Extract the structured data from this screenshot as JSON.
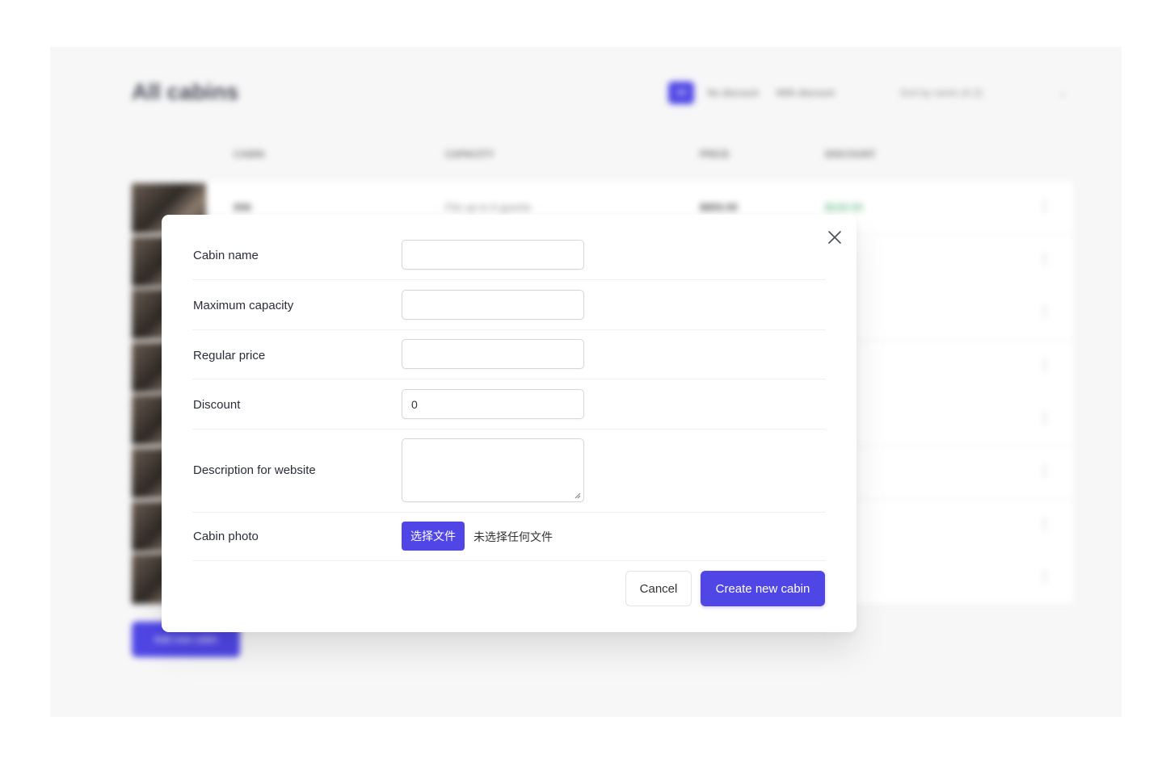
{
  "background": {
    "title": "All cabins",
    "filter": {
      "options": [
        "All",
        "No discount",
        "With discount"
      ],
      "active": "All"
    },
    "sort": "Sort by name (A-Z)",
    "table_headers": [
      "CABIN",
      "CAPACITY",
      "PRICE",
      "DISCOUNT"
    ],
    "first_row": {
      "name": "006",
      "capacity": "Fits up to 6 guests",
      "price": "$800.00",
      "discount": "$100.00"
    },
    "add_button": "Add new cabin"
  },
  "modal": {
    "close_icon": "close-icon",
    "fields": {
      "name": {
        "label": "Cabin name",
        "value": ""
      },
      "capacity": {
        "label": "Maximum capacity",
        "value": ""
      },
      "price": {
        "label": "Regular price",
        "value": ""
      },
      "discount": {
        "label": "Discount",
        "value": "0"
      },
      "description": {
        "label": "Description for website",
        "value": ""
      },
      "photo": {
        "label": "Cabin photo",
        "button": "选择文件",
        "status": "未选择任何文件"
      }
    },
    "buttons": {
      "cancel": "Cancel",
      "create": "Create new cabin"
    }
  },
  "colors": {
    "accent": "#4f46e5",
    "text": "#2b2e38",
    "border": "#d4d6dc"
  }
}
